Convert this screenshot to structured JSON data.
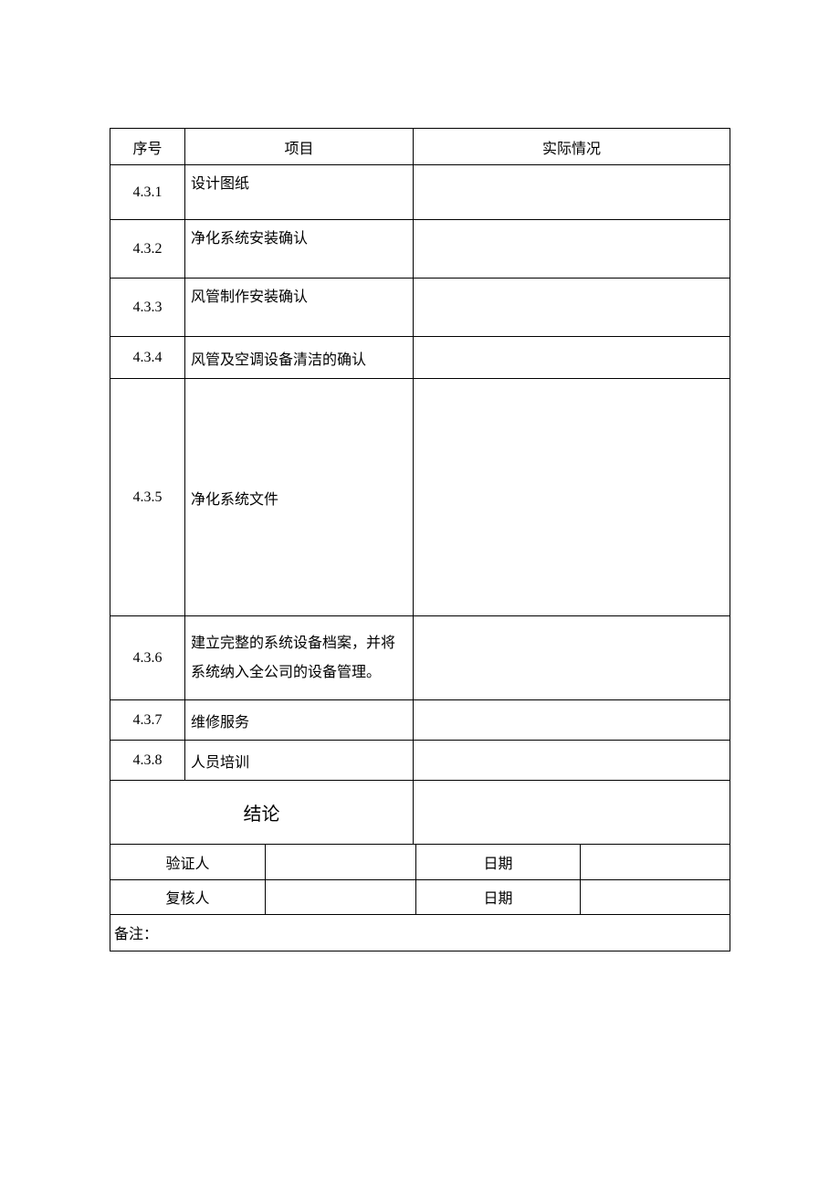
{
  "headers": {
    "seq": "序号",
    "item": "项目",
    "actual": "实际情况"
  },
  "rows": [
    {
      "seq": "4.3.1",
      "item": "设计图纸",
      "actual": ""
    },
    {
      "seq": "4.3.2",
      "item": "净化系统安装确认",
      "actual": ""
    },
    {
      "seq": "4.3.3",
      "item": "风管制作安装确认",
      "actual": ""
    },
    {
      "seq": "4.3.4",
      "item": "风管及空调设备清洁的确认",
      "actual": ""
    },
    {
      "seq": "4.3.5",
      "item": "净化系统文件",
      "actual": ""
    },
    {
      "seq": "4.3.6",
      "item": "建立完整的系统设备档案，并将系统纳入全公司的设备管理。",
      "actual": ""
    },
    {
      "seq": "4.3.7",
      "item": "维修服务",
      "actual": ""
    },
    {
      "seq": "4.3.8",
      "item": "人员培训",
      "actual": ""
    }
  ],
  "conclusion_label": "结论",
  "conclusion_value": "",
  "signoff": {
    "verifier_label": "验证人",
    "verifier_value": "",
    "verifier_date_label": "日期",
    "verifier_date_value": "",
    "reviewer_label": "复核人",
    "reviewer_value": "",
    "reviewer_date_label": "日期",
    "reviewer_date_value": ""
  },
  "note_label": "备注：",
  "note_value": ""
}
